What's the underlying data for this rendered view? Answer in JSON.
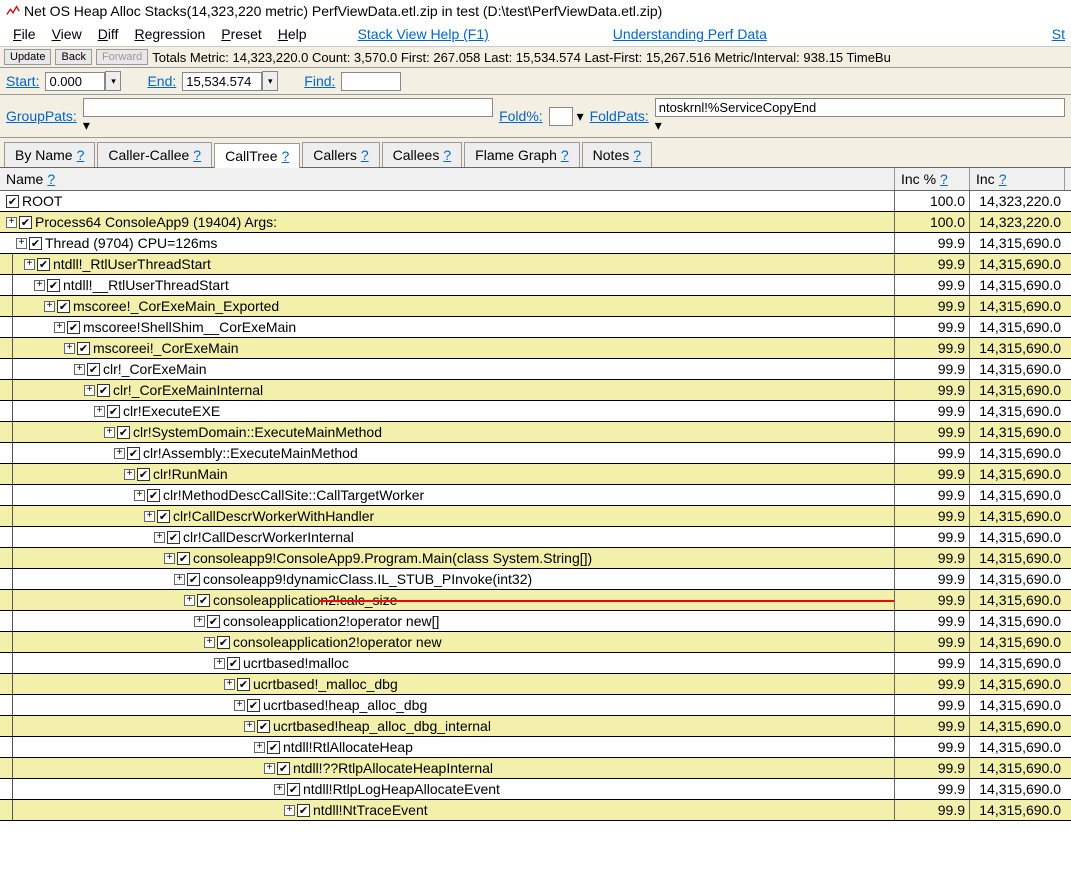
{
  "title": "Net OS Heap Alloc Stacks(14,323,220 metric) PerfViewData.etl.zip in test (D:\\test\\PerfViewData.etl.zip)",
  "menu": {
    "file": "File",
    "view": "View",
    "diff": "Diff",
    "regression": "Regression",
    "preset": "Preset",
    "help": "Help",
    "stackHelp": "Stack View Help (F1)",
    "understanding": "Understanding Perf Data",
    "st": "St"
  },
  "toolbar": {
    "update": "Update",
    "back": "Back",
    "forward": "Forward",
    "totals": "Totals Metric: 14,323,220.0  Count: 3,570.0  First: 267.058 Last: 15,534.574  Last-First: 15,267.516  Metric/Interval: 938.15  TimeBu"
  },
  "filter1": {
    "startLbl": "Start:",
    "start": "0.000",
    "endLbl": "End:",
    "end": "15,534.574",
    "findLbl": "Find:",
    "find": ""
  },
  "filter2": {
    "groupLbl": "GroupPats:",
    "group": "",
    "foldPctLbl": "Fold%:",
    "foldPct": "",
    "foldPatsLbl": "FoldPats:",
    "foldPats": "ntoskrnl!%ServiceCopyEnd"
  },
  "tabs": [
    {
      "label": "By Name",
      "active": false
    },
    {
      "label": "Caller-Callee",
      "active": false
    },
    {
      "label": "CallTree",
      "active": true
    },
    {
      "label": "Callers",
      "active": false
    },
    {
      "label": "Callees",
      "active": false
    },
    {
      "label": "Flame Graph",
      "active": false
    },
    {
      "label": "Notes",
      "active": false
    }
  ],
  "columns": {
    "name": "Name",
    "incPct": "Inc %",
    "inc": "Inc"
  },
  "rows": [
    {
      "depth": 0,
      "exp": "",
      "chk": true,
      "name": "ROOT",
      "pct": "100.0",
      "val": "14,323,220.0",
      "hl": false,
      "pipes": 0
    },
    {
      "depth": 0,
      "exp": "+",
      "chk": true,
      "name": "Process64 ConsoleApp9 (19404) Args:",
      "pct": "100.0",
      "val": "14,323,220.0",
      "hl": true,
      "pipes": 0
    },
    {
      "depth": 1,
      "exp": "+",
      "chk": true,
      "name": "Thread (9704) CPU=126ms",
      "pct": "99.9",
      "val": "14,315,690.0",
      "hl": false,
      "pipes": 0
    },
    {
      "depth": 1,
      "exp": "|+",
      "chk": true,
      "name": "ntdll!_RtlUserThreadStart",
      "pct": "99.9",
      "val": "14,315,690.0",
      "hl": true,
      "pipes": 1
    },
    {
      "depth": 2,
      "exp": "+",
      "chk": true,
      "name": "ntdll!__RtlUserThreadStart",
      "pct": "99.9",
      "val": "14,315,690.0",
      "hl": false,
      "pipes": 1
    },
    {
      "depth": 3,
      "exp": "+",
      "chk": true,
      "name": "mscoree!_CorExeMain_Exported",
      "pct": "99.9",
      "val": "14,315,690.0",
      "hl": true,
      "pipes": 1
    },
    {
      "depth": 4,
      "exp": "+",
      "chk": true,
      "name": "mscoree!ShellShim__CorExeMain",
      "pct": "99.9",
      "val": "14,315,690.0",
      "hl": false,
      "pipes": 1
    },
    {
      "depth": 5,
      "exp": "+",
      "chk": true,
      "name": "mscoreei!_CorExeMain",
      "pct": "99.9",
      "val": "14,315,690.0",
      "hl": true,
      "pipes": 1
    },
    {
      "depth": 6,
      "exp": "+",
      "chk": true,
      "name": "clr!_CorExeMain",
      "pct": "99.9",
      "val": "14,315,690.0",
      "hl": false,
      "pipes": 1
    },
    {
      "depth": 7,
      "exp": "+",
      "chk": true,
      "name": "clr!_CorExeMainInternal",
      "pct": "99.9",
      "val": "14,315,690.0",
      "hl": true,
      "pipes": 1
    },
    {
      "depth": 8,
      "exp": "+",
      "chk": true,
      "name": "clr!ExecuteEXE",
      "pct": "99.9",
      "val": "14,315,690.0",
      "hl": false,
      "pipes": 1
    },
    {
      "depth": 9,
      "exp": "+",
      "chk": true,
      "name": "clr!SystemDomain::ExecuteMainMethod",
      "pct": "99.9",
      "val": "14,315,690.0",
      "hl": true,
      "pipes": 1
    },
    {
      "depth": 10,
      "exp": "+",
      "chk": true,
      "name": "clr!Assembly::ExecuteMainMethod",
      "pct": "99.9",
      "val": "14,315,690.0",
      "hl": false,
      "pipes": 1
    },
    {
      "depth": 11,
      "exp": "+",
      "chk": true,
      "name": "clr!RunMain",
      "pct": "99.9",
      "val": "14,315,690.0",
      "hl": true,
      "pipes": 1
    },
    {
      "depth": 12,
      "exp": "+",
      "chk": true,
      "name": "clr!MethodDescCallSite::CallTargetWorker",
      "pct": "99.9",
      "val": "14,315,690.0",
      "hl": false,
      "pipes": 1
    },
    {
      "depth": 13,
      "exp": "+",
      "chk": true,
      "name": "clr!CallDescrWorkerWithHandler",
      "pct": "99.9",
      "val": "14,315,690.0",
      "hl": true,
      "pipes": 1
    },
    {
      "depth": 14,
      "exp": "+",
      "chk": true,
      "name": "clr!CallDescrWorkerInternal",
      "pct": "99.9",
      "val": "14,315,690.0",
      "hl": false,
      "pipes": 1
    },
    {
      "depth": 15,
      "exp": "+",
      "chk": true,
      "name": "consoleapp9!ConsoleApp9.Program.Main(class System.String[])",
      "pct": "99.9",
      "val": "14,315,690.0",
      "hl": true,
      "pipes": 1
    },
    {
      "depth": 16,
      "exp": "+",
      "chk": true,
      "name": "consoleapp9!dynamicClass.IL_STUB_PInvoke(int32)",
      "pct": "99.9",
      "val": "14,315,690.0",
      "hl": false,
      "pipes": 1
    },
    {
      "depth": 17,
      "exp": "+",
      "chk": true,
      "name": "consoleapplication2!calc_size",
      "pct": "99.9",
      "val": "14,315,690.0",
      "hl": true,
      "pipes": 1,
      "arrow": true
    },
    {
      "depth": 18,
      "exp": "+",
      "chk": true,
      "name": "consoleapplication2!operator new[]",
      "pct": "99.9",
      "val": "14,315,690.0",
      "hl": false,
      "pipes": 1
    },
    {
      "depth": 19,
      "exp": "+",
      "chk": true,
      "name": "consoleapplication2!operator new",
      "pct": "99.9",
      "val": "14,315,690.0",
      "hl": true,
      "pipes": 1
    },
    {
      "depth": 20,
      "exp": "+",
      "chk": true,
      "name": "ucrtbased!malloc",
      "pct": "99.9",
      "val": "14,315,690.0",
      "hl": false,
      "pipes": 1
    },
    {
      "depth": 21,
      "exp": "+",
      "chk": true,
      "name": "ucrtbased!_malloc_dbg",
      "pct": "99.9",
      "val": "14,315,690.0",
      "hl": true,
      "pipes": 1
    },
    {
      "depth": 22,
      "exp": "+",
      "chk": true,
      "name": "ucrtbased!heap_alloc_dbg",
      "pct": "99.9",
      "val": "14,315,690.0",
      "hl": false,
      "pipes": 1
    },
    {
      "depth": 23,
      "exp": "+",
      "chk": true,
      "name": "ucrtbased!heap_alloc_dbg_internal",
      "pct": "99.9",
      "val": "14,315,690.0",
      "hl": true,
      "pipes": 1
    },
    {
      "depth": 24,
      "exp": "+",
      "chk": true,
      "name": "ntdll!RtlAllocateHeap",
      "pct": "99.9",
      "val": "14,315,690.0",
      "hl": false,
      "pipes": 1
    },
    {
      "depth": 25,
      "exp": "+",
      "chk": true,
      "name": "ntdll!??RtlpAllocateHeapInternal",
      "pct": "99.9",
      "val": "14,315,690.0",
      "hl": true,
      "pipes": 1
    },
    {
      "depth": 26,
      "exp": "+",
      "chk": true,
      "name": "ntdll!RtlpLogHeapAllocateEvent",
      "pct": "99.9",
      "val": "14,315,690.0",
      "hl": false,
      "pipes": 1
    },
    {
      "depth": 27,
      "exp": "+",
      "chk": true,
      "name": "ntdll!NtTraceEvent",
      "pct": "99.9",
      "val": "14,315,690.0",
      "hl": true,
      "pipes": 1
    }
  ]
}
